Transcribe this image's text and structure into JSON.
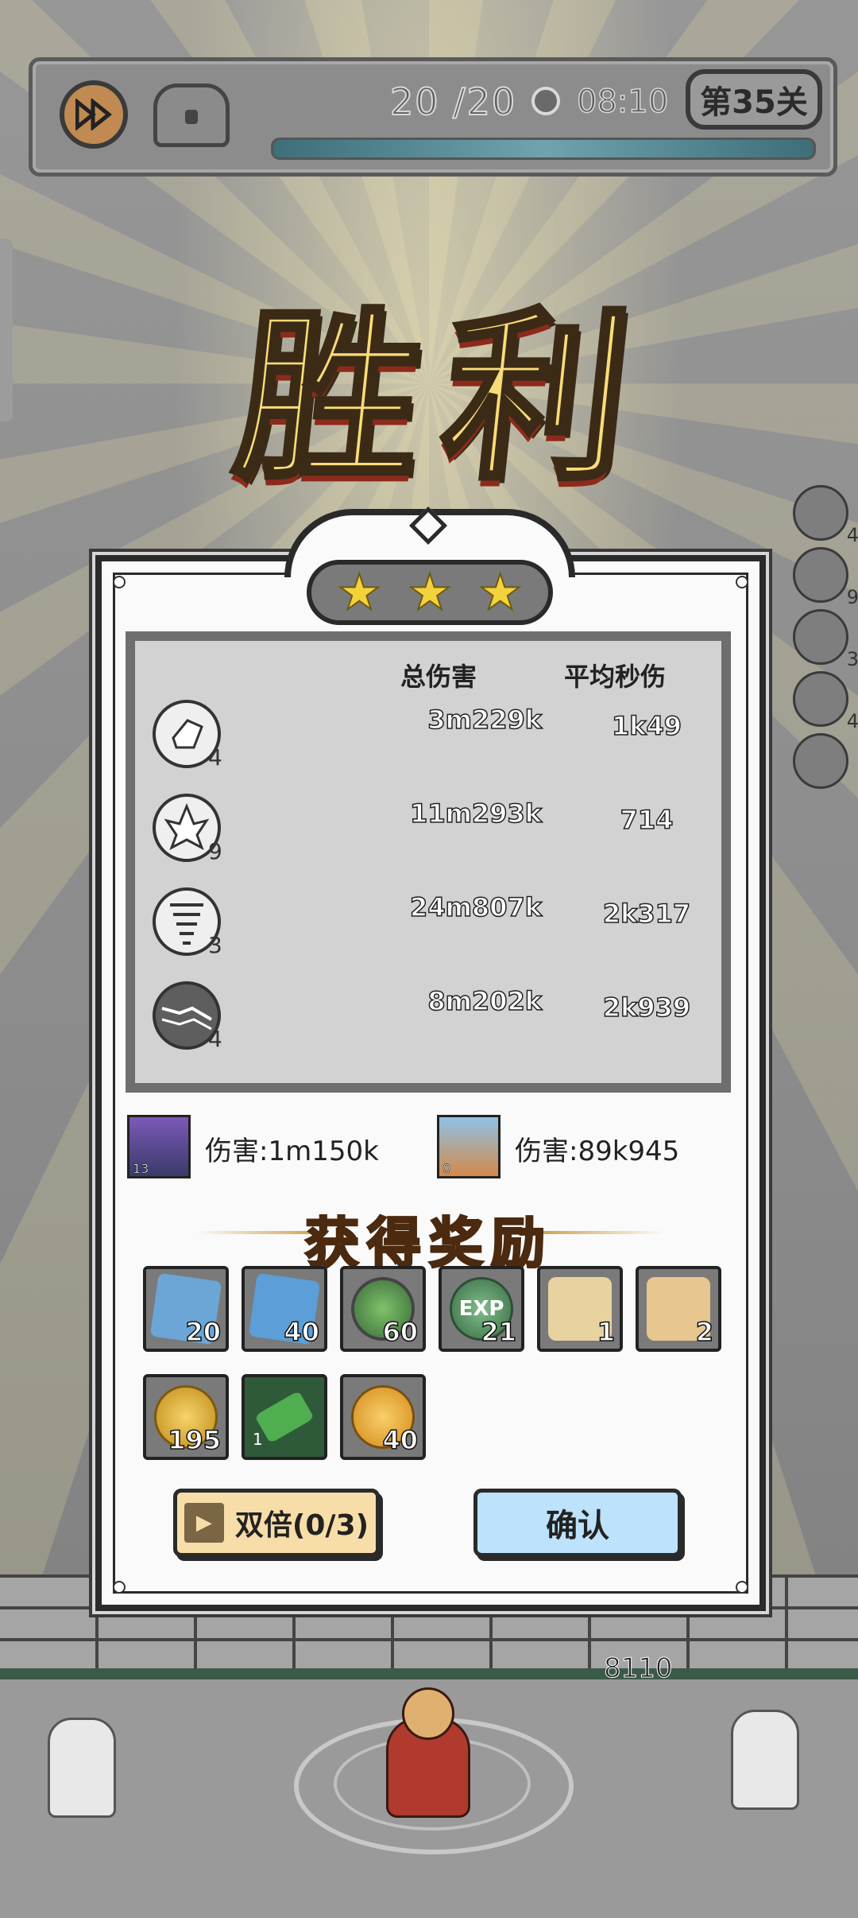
{
  "hud": {
    "wave": "20 /20",
    "timer": "08:10",
    "level": "第35关"
  },
  "victory_text": "胜利",
  "side_skills": [
    {
      "count": "4"
    },
    {
      "count": "9"
    },
    {
      "count": "3"
    },
    {
      "count": "4"
    },
    {
      "count": ""
    }
  ],
  "stars": {
    "earned": 3,
    "total": 3
  },
  "stats": {
    "header_total": "总伤害",
    "header_dps": "平均秒伤",
    "rows": [
      {
        "icon": "ice-shard-icon",
        "level": "4",
        "total": "3m229k",
        "dps": "1k49"
      },
      {
        "icon": "ice-crystal-icon",
        "level": "9",
        "total": "11m293k",
        "dps": "714"
      },
      {
        "icon": "tornado-icon",
        "level": "3",
        "total": "24m807k",
        "dps": "2k317"
      },
      {
        "icon": "lightning-icon",
        "level": "4",
        "total": "8m202k",
        "dps": "2k939"
      }
    ]
  },
  "heroes": [
    {
      "level": "13",
      "damage": "伤害:1m150k"
    },
    {
      "level": "0",
      "damage": "伤害:89k945"
    }
  ],
  "reward_title": "获得奖励",
  "rewards": [
    {
      "name": "lightning-scroll-icon",
      "qty": "20",
      "color": "#6ba6d6"
    },
    {
      "name": "ice-spirit-icon",
      "qty": "40",
      "color": "#5c9ed8"
    },
    {
      "name": "leaf-gem-icon",
      "qty": "60",
      "color": "#4a8a4a"
    },
    {
      "name": "exp-orb-icon",
      "qty": "21",
      "label": "EXP",
      "color": "#4f8a5a"
    },
    {
      "name": "scroll-icon",
      "qty": "1",
      "color": "#e8d3a0"
    },
    {
      "name": "scroll-rune-icon",
      "qty": "2",
      "color": "#e8c690"
    },
    {
      "name": "gold-gem-coin-icon",
      "qty": "195",
      "color": "#e0b43a"
    },
    {
      "name": "green-crystal-icon",
      "qty": "",
      "corner": "1",
      "color": "#4fae4f"
    },
    {
      "name": "gold-star-coin-icon",
      "qty": "40",
      "color": "#f2b43a"
    }
  ],
  "buttons": {
    "double": "双倍(0/3)",
    "confirm": "确认"
  },
  "scene": {
    "hp": "8110"
  }
}
